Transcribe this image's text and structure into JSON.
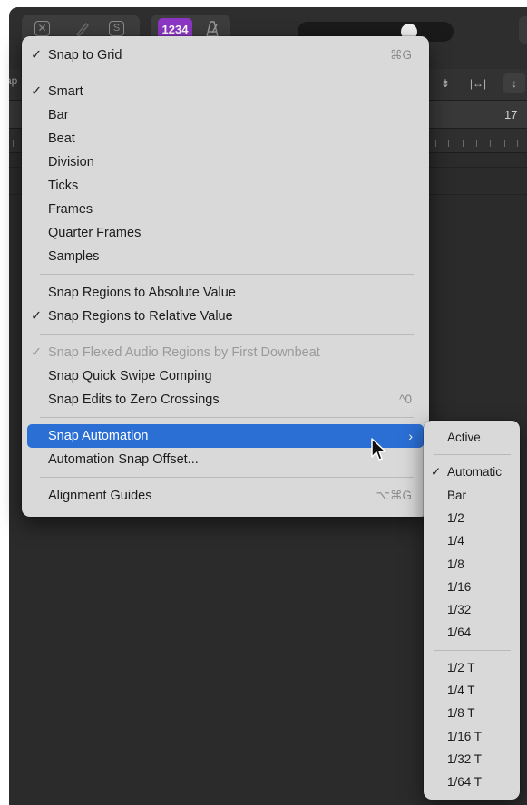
{
  "app": {
    "lcd_mode_label": "1234",
    "ruler_left_label": "ap",
    "bar_number": "17"
  },
  "snap_menu": {
    "sections": [
      [
        {
          "label": "Snap to Grid",
          "checked": true,
          "shortcut": "⌘G"
        }
      ],
      [
        {
          "label": "Smart",
          "checked": true
        },
        {
          "label": "Bar"
        },
        {
          "label": "Beat"
        },
        {
          "label": "Division"
        },
        {
          "label": "Ticks"
        },
        {
          "label": "Frames"
        },
        {
          "label": "Quarter Frames"
        },
        {
          "label": "Samples"
        }
      ],
      [
        {
          "label": "Snap Regions to Absolute Value"
        },
        {
          "label": "Snap Regions to Relative Value",
          "checked": true
        }
      ],
      [
        {
          "label": "Snap Flexed Audio Regions by First Downbeat",
          "checked": true,
          "disabled": true
        },
        {
          "label": "Snap Quick Swipe Comping"
        },
        {
          "label": "Snap Edits to Zero Crossings",
          "shortcut": "^0"
        }
      ],
      [
        {
          "label": "Snap Automation",
          "highlighted": true,
          "submenu": true
        },
        {
          "label": "Automation Snap Offset..."
        }
      ],
      [
        {
          "label": "Alignment Guides",
          "shortcut": "⌥⌘G"
        }
      ]
    ]
  },
  "snap_automation_submenu": {
    "sections": [
      [
        {
          "label": "Active"
        }
      ],
      [
        {
          "label": "Automatic",
          "checked": true
        },
        {
          "label": "Bar"
        },
        {
          "label": "1/2"
        },
        {
          "label": "1/4"
        },
        {
          "label": "1/8"
        },
        {
          "label": "1/16"
        },
        {
          "label": "1/32"
        },
        {
          "label": "1/64"
        }
      ],
      [
        {
          "label": "1/2 T"
        },
        {
          "label": "1/4 T"
        },
        {
          "label": "1/8 T"
        },
        {
          "label": "1/16 T"
        },
        {
          "label": "1/32 T"
        },
        {
          "label": "1/64 T"
        }
      ]
    ]
  },
  "symbols": {
    "check": "✓",
    "submenu_arrow": "›"
  },
  "colors": {
    "menu_background": "#d9d9d9",
    "highlight": "#2b6fd5",
    "lcd_badge": "#8d36c5"
  },
  "icons": [
    "close-box-icon",
    "pencil-icon",
    "solo-icon",
    "metronome-icon",
    "vertical-zoom-icon",
    "fit-width-icon",
    "vertical-resize-icon",
    "mouse-pointer-icon"
  ]
}
